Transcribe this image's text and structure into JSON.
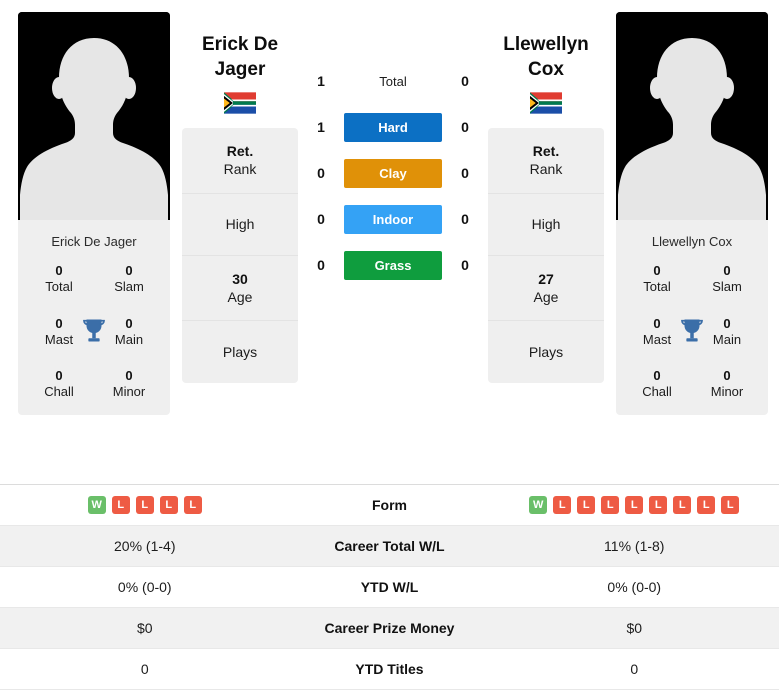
{
  "players": [
    {
      "name": "Erick De Jager",
      "name_header": "Erick De\nJager",
      "name_line1": "Erick De",
      "name_line2": "Jager",
      "country": "South Africa",
      "flag": "za-flag-icon",
      "photo": "player-photo-placeholder",
      "titles": [
        {
          "label": "Total",
          "value": "0"
        },
        {
          "label": "Slam",
          "value": "0"
        },
        {
          "label": "Mast",
          "value": "0"
        },
        {
          "label": "Main",
          "value": "0"
        },
        {
          "label": "Chall",
          "value": "0"
        },
        {
          "label": "Minor",
          "value": "0"
        }
      ],
      "meta": [
        {
          "value": "Ret.",
          "label": "Rank"
        },
        {
          "value": "",
          "label": "High"
        },
        {
          "value": "30",
          "label": "Age"
        },
        {
          "value": "",
          "label": "Plays"
        }
      ],
      "form": [
        "W",
        "L",
        "L",
        "L",
        "L"
      ],
      "career_total_wl": "20% (1-4)",
      "ytd_wl": "0% (0-0)",
      "career_prize_money": "$0",
      "ytd_titles": "0"
    },
    {
      "name": "Llewellyn Cox",
      "name_header": "Llewellyn\nCox",
      "name_line1": "Llewellyn",
      "name_line2": "Cox",
      "country": "South Africa",
      "flag": "za-flag-icon",
      "photo": "player-photo-placeholder",
      "titles": [
        {
          "label": "Total",
          "value": "0"
        },
        {
          "label": "Slam",
          "value": "0"
        },
        {
          "label": "Mast",
          "value": "0"
        },
        {
          "label": "Main",
          "value": "0"
        },
        {
          "label": "Chall",
          "value": "0"
        },
        {
          "label": "Minor",
          "value": "0"
        }
      ],
      "meta": [
        {
          "value": "Ret.",
          "label": "Rank"
        },
        {
          "value": "",
          "label": "High"
        },
        {
          "value": "27",
          "label": "Age"
        },
        {
          "value": "",
          "label": "Plays"
        }
      ],
      "form": [
        "W",
        "L",
        "L",
        "L",
        "L",
        "L",
        "L",
        "L",
        "L"
      ],
      "career_total_wl": "11% (1-8)",
      "ytd_wl": "0% (0-0)",
      "career_prize_money": "$0",
      "ytd_titles": "0"
    }
  ],
  "head_to_head": [
    {
      "surface": "Total",
      "left": "1",
      "right": "0",
      "color": "",
      "plain": true
    },
    {
      "surface": "Hard",
      "left": "1",
      "right": "0",
      "color": "#0c70c4",
      "plain": false
    },
    {
      "surface": "Clay",
      "left": "0",
      "right": "0",
      "color": "#e09108",
      "plain": false
    },
    {
      "surface": "Indoor",
      "left": "0",
      "right": "0",
      "color": "#34a2f5",
      "plain": false
    },
    {
      "surface": "Grass",
      "left": "0",
      "right": "0",
      "color": "#0f9d3e",
      "plain": false
    }
  ],
  "stats_table": [
    {
      "label": "Form",
      "left": "",
      "right": "",
      "is_form": true
    },
    {
      "label": "Career Total W/L",
      "left": "20% (1-4)",
      "right": "11% (1-8)",
      "is_form": false
    },
    {
      "label": "YTD W/L",
      "left": "0% (0-0)",
      "right": "0% (0-0)",
      "is_form": false
    },
    {
      "label": "Career Prize Money",
      "left": "$0",
      "right": "$0",
      "is_form": false
    },
    {
      "label": "YTD Titles",
      "left": "0",
      "right": "0",
      "is_form": false
    }
  ],
  "colors": {
    "hard": "#0c70c4",
    "clay": "#e09108",
    "indoor": "#34a2f5",
    "grass": "#0f9d3e",
    "win_badge": "#6abf69",
    "loss_badge": "#ee5b44",
    "trophy": "#3b6ea8",
    "card_bg": "#efefef",
    "row_alt_bg": "#f1f1f1"
  }
}
